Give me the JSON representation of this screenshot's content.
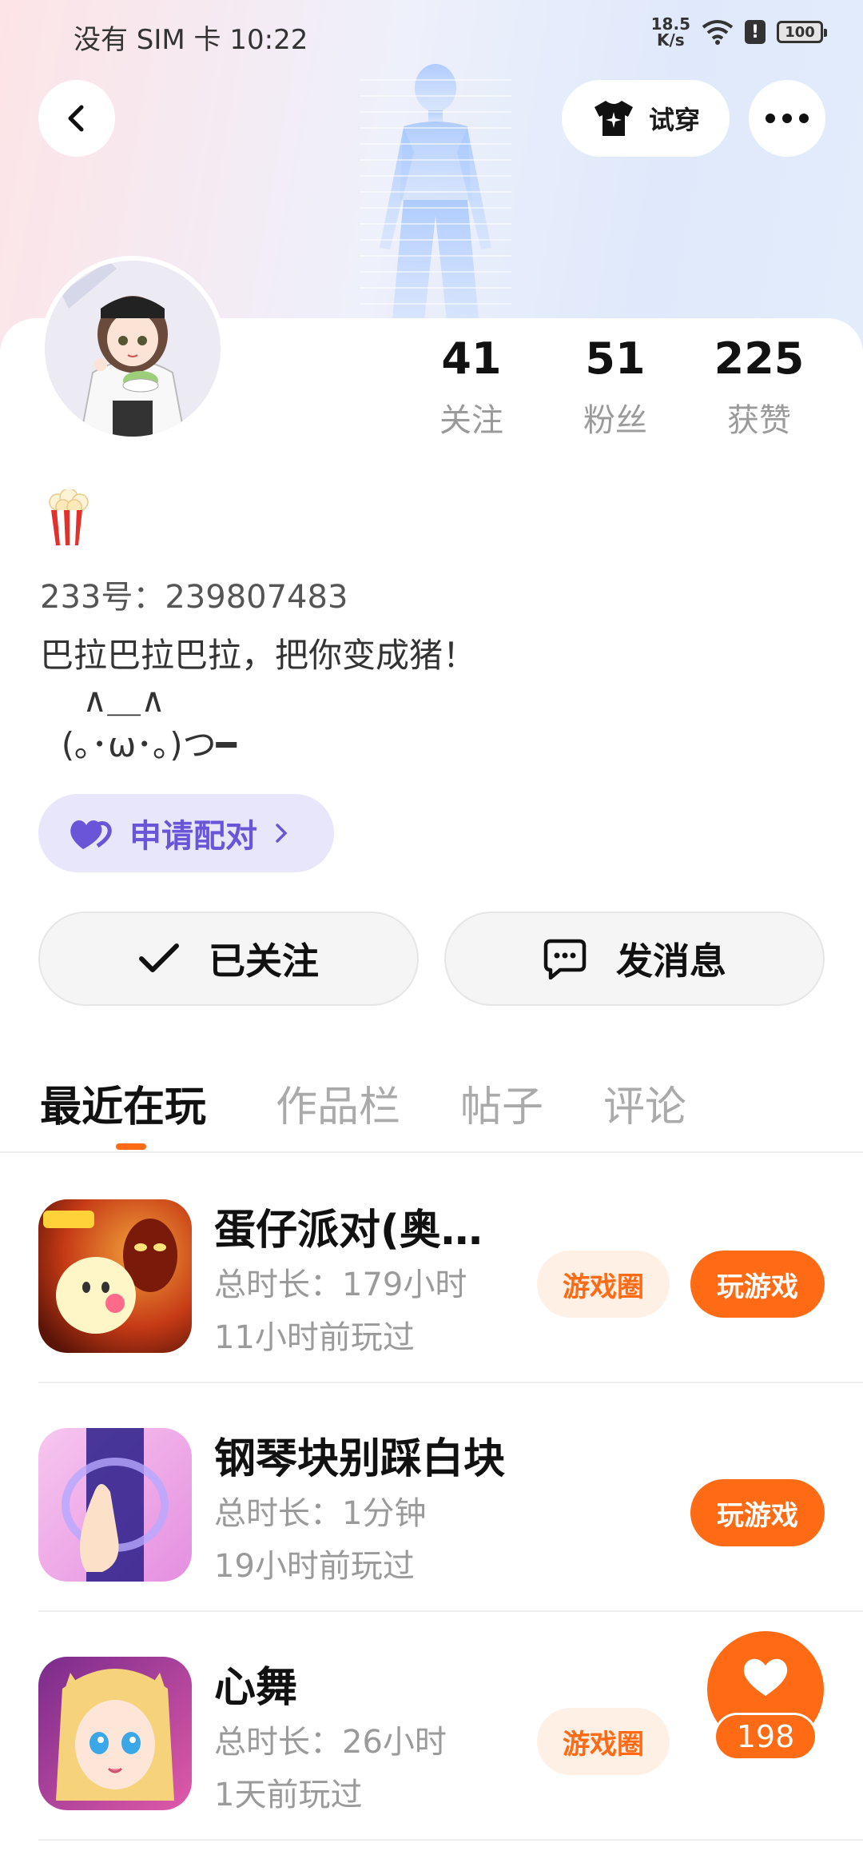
{
  "status_bar": {
    "carrier_time": "没有 SIM 卡 10:22",
    "speed_value": "18.5",
    "speed_unit": "K/s",
    "battery": "100"
  },
  "header": {
    "try_on_label": "试穿",
    "back_icon": "back-arrow-icon",
    "more_icon": "more-dots-icon"
  },
  "profile": {
    "stats": [
      {
        "value": "41",
        "label": "关注"
      },
      {
        "value": "51",
        "label": "粉丝"
      },
      {
        "value": "225",
        "label": "获赞"
      }
    ],
    "badge_icon": "popcorn-icon",
    "uid": "233号：239807483",
    "bio": "巴拉巴拉巴拉，把你变成猪！\n    ∧＿∧\n  (｡･ω･｡)つ━",
    "pair_label": "申请配对",
    "follow_label": "已关注",
    "message_label": "发消息"
  },
  "tabs": [
    {
      "label": "最近在玩"
    },
    {
      "label": "作品栏"
    },
    {
      "label": "帖子"
    },
    {
      "label": "评论"
    }
  ],
  "games": [
    {
      "title": "蛋仔派对(奥…",
      "duration": "总时长：179小时",
      "played": "11小时前玩过",
      "circle_label": "游戏圈",
      "play_label": "玩游戏"
    },
    {
      "title": "钢琴块别踩白块",
      "duration": "总时长：1分钟",
      "played": "19小时前玩过",
      "circle_label": "",
      "play_label": "玩游戏"
    },
    {
      "title": "心舞",
      "duration": "总时长：26小时",
      "played": "1天前玩过",
      "circle_label": "游戏圈",
      "play_label": ""
    }
  ],
  "like_fab": {
    "count": "198"
  },
  "colors": {
    "accent": "#ff6a14",
    "pair_bg": "#e8e6fb",
    "pair_text": "#6a55d8"
  }
}
